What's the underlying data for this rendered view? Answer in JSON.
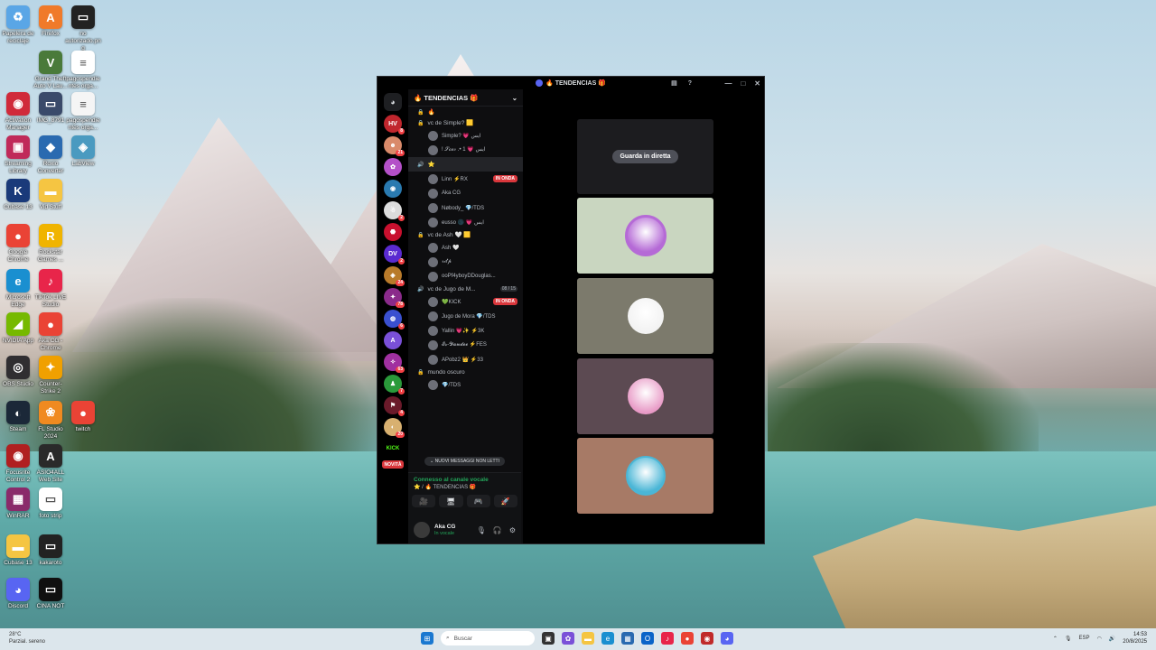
{
  "desktop": {
    "icons": [
      {
        "label": "Papelera de reciclaje",
        "icon": "recycle-bin-icon",
        "color": "#5aa6e6",
        "glyph": "♻"
      },
      {
        "label": "Firefox",
        "icon": "app-icon",
        "color": "#f07a2a",
        "glyph": "A"
      },
      {
        "label": "no autorizado.png",
        "icon": "image-file-icon",
        "color": "#222222",
        "glyph": "▭"
      },
      {
        "label": "Grand Theft Auto V Lau...",
        "icon": "gta-icon",
        "color": "#4a7a3a",
        "glyph": "V"
      },
      {
        "label": "pagospendientes orga...",
        "icon": "document-icon",
        "color": "#ffffff",
        "glyph": "≡"
      },
      {
        "label": "Activation Manager",
        "icon": "activation-icon",
        "color": "#d02a3a",
        "glyph": "◉"
      },
      {
        "label": "IMG_8791",
        "icon": "image-file-icon",
        "color": "#3a4a6a",
        "glyph": "▭"
      },
      {
        "label": "pagospendientes orga...",
        "icon": "document-icon",
        "color": "#f5f5f5",
        "glyph": "≡"
      },
      {
        "label": "Streaming Library",
        "icon": "streaming-icon",
        "color": "#c02a5a",
        "glyph": "▣"
      },
      {
        "label": "Roxio Converter",
        "icon": "roxio-icon",
        "color": "#2a6ab0",
        "glyph": "◆"
      },
      {
        "label": "LabView",
        "icon": "labview-icon",
        "color": "#4a9ac0",
        "glyph": "◈"
      },
      {
        "label": "Cubase 13",
        "icon": "cubase-icon",
        "color": "#1a3a7a",
        "glyph": "K"
      },
      {
        "label": "Vid Stuff",
        "icon": "folder-icon",
        "color": "#f5c542",
        "glyph": "▬"
      },
      {
        "label": "Google Chrome",
        "icon": "chrome-icon",
        "color": "#ea4335",
        "glyph": "●"
      },
      {
        "label": "Rockstar Games ...",
        "icon": "rockstar-icon",
        "color": "#f0b400",
        "glyph": "R"
      },
      {
        "label": "Microsoft Edge",
        "icon": "edge-icon",
        "color": "#1a8fd0",
        "glyph": "e"
      },
      {
        "label": "TikTok LIVE Studio",
        "icon": "tiktok-icon",
        "color": "#e8254a",
        "glyph": "♪"
      },
      {
        "label": "NVIDIA App",
        "icon": "nvidia-icon",
        "color": "#76b900",
        "glyph": "◢"
      },
      {
        "label": "Aka CG - Chrome",
        "icon": "chrome-icon",
        "color": "#ea4335",
        "glyph": "●"
      },
      {
        "label": "OBS Studio",
        "icon": "obs-icon",
        "color": "#302e31",
        "glyph": "◎"
      },
      {
        "label": "Counter-Strike 2",
        "icon": "cs-icon",
        "color": "#f0a000",
        "glyph": "✦"
      },
      {
        "label": "Steam",
        "icon": "steam-icon",
        "color": "#1b2838",
        "glyph": "◐"
      },
      {
        "label": "FL Studio 2024",
        "icon": "flstudio-icon",
        "color": "#f08a20",
        "glyph": "❀"
      },
      {
        "label": "twitch",
        "icon": "chrome-icon",
        "color": "#ea4335",
        "glyph": "●"
      },
      {
        "label": "Focusrite Control 2",
        "icon": "focusrite-icon",
        "color": "#b02020",
        "glyph": "◉"
      },
      {
        "label": "ASIO4ALL Web Site",
        "icon": "asio-icon",
        "color": "#2a2a2a",
        "glyph": "A"
      },
      {
        "label": "WinRAR",
        "icon": "winrar-icon",
        "color": "#8a2a6a",
        "glyph": "▦"
      },
      {
        "label": "foto strip",
        "icon": "document-icon",
        "color": "#ffffff",
        "glyph": "▭"
      },
      {
        "label": "Cubase 13",
        "icon": "folder-icon",
        "color": "#f5c542",
        "glyph": "▬"
      },
      {
        "label": "kakaroto",
        "icon": "image-file-icon",
        "color": "#222222",
        "glyph": "▭"
      },
      {
        "label": "Discord",
        "icon": "discord-icon",
        "color": "#5865f2",
        "glyph": "◕"
      },
      {
        "label": "CINA NOT",
        "icon": "image-file-icon",
        "color": "#101010",
        "glyph": "▭"
      }
    ]
  },
  "window": {
    "title": "🔥 TENDENCIAS 🎁",
    "controls": {
      "minimize": "—",
      "maximize": "□",
      "close": "✕",
      "help": "?",
      "inbox": "▤"
    }
  },
  "servers": [
    {
      "label": "HV",
      "color": "#c0262d",
      "badge": "8"
    },
    {
      "label": "☻",
      "color": "#d98a6a",
      "badge": "21"
    },
    {
      "label": "✿",
      "color": "#b450c8",
      "badge": ""
    },
    {
      "label": "◉",
      "color": "#2a7ab0",
      "badge": ""
    },
    {
      "label": "☃",
      "color": "#dcdcdc",
      "badge": "2"
    },
    {
      "label": "⬣",
      "color": "#c8102e",
      "badge": ""
    },
    {
      "label": "DV",
      "color": "#5a2ad0",
      "badge": "2"
    },
    {
      "label": "◈",
      "color": "#b87a2a",
      "badge": "24"
    },
    {
      "label": "✦",
      "color": "#8a2a8a",
      "badge": "78"
    },
    {
      "label": "◍",
      "color": "#3a50d0",
      "badge": "6"
    },
    {
      "label": "A",
      "color": "#7a50d8",
      "badge": ""
    },
    {
      "label": "✧",
      "color": "#a030a0",
      "badge": "63"
    },
    {
      "label": "♟",
      "color": "#2a9a3a",
      "badge": "7"
    },
    {
      "label": "⚑",
      "color": "#6a1a2a",
      "badge": "4"
    },
    {
      "label": "◐",
      "color": "#d8b070",
      "badge": "20"
    },
    {
      "label": "KICK",
      "color": "#000000",
      "badge": ""
    }
  ],
  "novita_label": "NOVITÀ",
  "guild": {
    "name": "🔥 TENDENCIAS 🎁",
    "chevron": "⌄"
  },
  "channels": [
    {
      "kind": "channel",
      "name": "🔥",
      "icon": "🔒"
    },
    {
      "kind": "channel",
      "name": "vc de Simple? 🟨",
      "icon": "🔒"
    },
    {
      "kind": "user",
      "name": "Simple? 💗 ايس",
      "live": ""
    },
    {
      "kind": "user",
      "name": "! 𝒮𝒸𝒶𝓇 .• 1 💗 ايس",
      "live": ""
    },
    {
      "kind": "channel",
      "name": "⭐",
      "icon": "🔊"
    },
    {
      "kind": "user",
      "name": "Linn ⚡RX",
      "live": "IN ONDA"
    },
    {
      "kind": "user",
      "name": "Aka CG",
      "live": ""
    },
    {
      "kind": "user",
      "name": "Nøbody_ 💎/TDS",
      "live": ""
    },
    {
      "kind": "user",
      "name": "eusso 🌑 💗 ايس",
      "live": ""
    },
    {
      "kind": "channel",
      "name": "vc de Ash 🤍 🟨",
      "icon": "🔒"
    },
    {
      "kind": "user",
      "name": "Ash 🤍",
      "live": ""
    },
    {
      "kind": "user",
      "name": "𝓇𝒾𝓉𝓅",
      "live": ""
    },
    {
      "kind": "user",
      "name": "ooPf4yboyDDouglas...",
      "live": ""
    },
    {
      "kind": "channel",
      "name": "vc de Jugo de M...",
      "icon": "🔊"
    },
    {
      "kind": "user",
      "name": "💚KICK",
      "live": "IN ONDA"
    },
    {
      "kind": "user",
      "name": "Jugo de Mora 💎/TDS",
      "live": ""
    },
    {
      "kind": "user",
      "name": "Yallin 💗✨ ⚡3K",
      "live": ""
    },
    {
      "kind": "user",
      "name": "𝓔𝓻-𝓨𝓪𝓷𝓭𝓮𝓮 ⚡FES",
      "live": ""
    },
    {
      "kind": "user",
      "name": "APobz2 👑 ⚡33",
      "live": ""
    },
    {
      "kind": "channel",
      "name": "mundo oscuro",
      "icon": "🔒"
    },
    {
      "kind": "user",
      "name": "💎/TDS",
      "live": ""
    }
  ],
  "voice_counter": "08 / 15",
  "new_messages": "⌄ NUOVI MESSAGGI NON LETTI",
  "voice_panel": {
    "status": "Connesso al canale vocale",
    "channel": "⭐ / 🔥 TENDENCIAS 🎁",
    "buttons": [
      "🎥",
      "🖥",
      "🎮",
      "🚀"
    ]
  },
  "user_panel": {
    "name": "Aka CG",
    "status": "In vocale"
  },
  "stage": {
    "watch_button": "Guarda in diretta",
    "tiles": [
      {
        "bg": "#1c1c1f"
      },
      {
        "bg": "#c9d6c0",
        "avatar": "#b56ad6"
      },
      {
        "bg": "#7c7a6c",
        "avatar": "#f2f2f2"
      },
      {
        "bg": "#5c4a52",
        "avatar": "#e89ac6"
      },
      {
        "bg": "#a77a66",
        "avatar": "#4ab6d6"
      }
    ]
  },
  "taskbar": {
    "weather_temp": "28°C",
    "weather_desc": "Parzial. sereno",
    "search_placeholder": "Buscar",
    "lang": "ESP",
    "time": "14:53",
    "date": "20/8/2025",
    "apps": [
      {
        "icon": "windows-start-icon",
        "color": "#1a78d0",
        "glyph": "⊞"
      },
      {
        "icon": "task-view-icon",
        "color": "#333333",
        "glyph": "▣"
      },
      {
        "icon": "copilot-icon",
        "color": "#7a50d8",
        "glyph": "✿"
      },
      {
        "icon": "explorer-icon",
        "color": "#f5c542",
        "glyph": "▬"
      },
      {
        "icon": "edge-icon",
        "color": "#1a8fd0",
        "glyph": "e"
      },
      {
        "icon": "store-icon",
        "color": "#2a6ab0",
        "glyph": "▦"
      },
      {
        "icon": "outlook-icon",
        "color": "#0a64c8",
        "glyph": "O"
      },
      {
        "icon": "tiktok-icon",
        "color": "#e8254a",
        "glyph": "♪"
      },
      {
        "icon": "chrome-icon",
        "color": "#ea4335",
        "glyph": "●"
      },
      {
        "icon": "app-icon",
        "color": "#c02a2a",
        "glyph": "◉"
      },
      {
        "icon": "discord-icon",
        "color": "#5865f2",
        "glyph": "◕"
      }
    ]
  }
}
